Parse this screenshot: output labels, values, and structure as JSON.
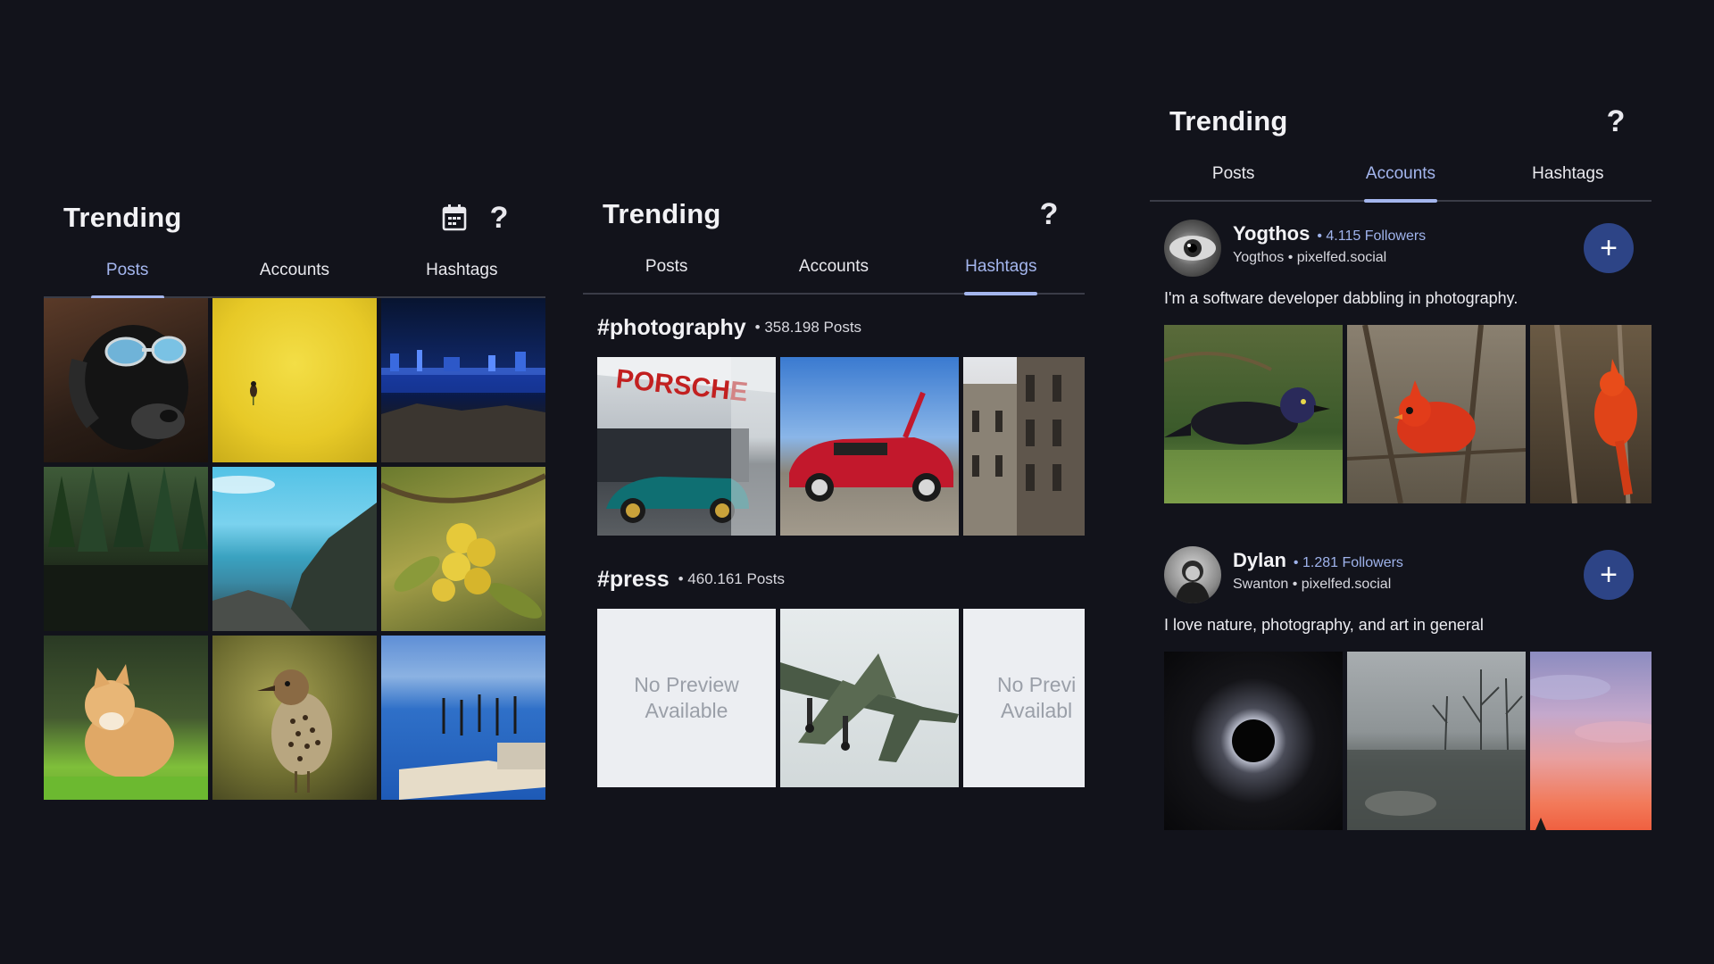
{
  "posts_panel": {
    "title": "Trending",
    "icons": [
      "calendar-icon",
      "help-icon"
    ],
    "help_glyph": "?",
    "tabs": [
      {
        "label": "Posts",
        "active": true
      },
      {
        "label": "Accounts",
        "active": false
      },
      {
        "label": "Hashtags",
        "active": false
      }
    ],
    "images": [
      "dog-with-sunglasses",
      "bird-in-yellow-field",
      "city-skyline-night",
      "forest-lake",
      "rocky-coast",
      "fruit-on-branch",
      "orange-cat",
      "thrush-bird",
      "harbor-pier"
    ]
  },
  "hashtags_panel": {
    "title": "Trending",
    "icons": [
      "help-icon"
    ],
    "help_glyph": "?",
    "tabs": [
      {
        "label": "Posts",
        "active": false
      },
      {
        "label": "Accounts",
        "active": false
      },
      {
        "label": "Hashtags",
        "active": true
      }
    ],
    "hashtags": [
      {
        "name": "#photography",
        "meta": "• 358.198 Posts",
        "images": [
          "porsche-showroom",
          "red-sports-car",
          "cathedral-facade"
        ]
      },
      {
        "name": "#press",
        "meta": "• 460.161 Posts",
        "no_preview": "No Preview Available",
        "no_preview_lines": [
          "No Preview",
          "Available"
        ],
        "no_preview_clipped_lines": [
          "No Previ",
          "Availabl"
        ],
        "images": [
          "no-preview",
          "fighter-jet",
          "no-preview"
        ]
      }
    ]
  },
  "accounts_panel": {
    "title": "Trending",
    "icons": [
      "help-icon"
    ],
    "help_glyph": "?",
    "tabs": [
      {
        "label": "Posts",
        "active": false
      },
      {
        "label": "Accounts",
        "active": true
      },
      {
        "label": "Hashtags",
        "active": false
      }
    ],
    "follow_glyph": "+",
    "accounts": [
      {
        "name": "Yogthos",
        "followers": "• 4.115 Followers",
        "handle": "Yogthos • pixelfed.social",
        "bio": "I'm a software developer dabbling in photography.",
        "images": [
          "grackle-bird",
          "cardinal-bird",
          "cardinal-bird-2"
        ]
      },
      {
        "name": "Dylan",
        "followers": "• 1.281 Followers",
        "handle": "Swanton • pixelfed.social",
        "bio": "I love nature, photography, and art in general",
        "images": [
          "solar-eclipse",
          "misty-pond",
          "sunset-sky"
        ]
      }
    ]
  },
  "colors": {
    "background": "#12131b",
    "accent": "#a4b6ee",
    "follow_button": "#2d4486",
    "no_preview_bg": "#eceef2",
    "no_preview_text": "#9a9fa8"
  }
}
